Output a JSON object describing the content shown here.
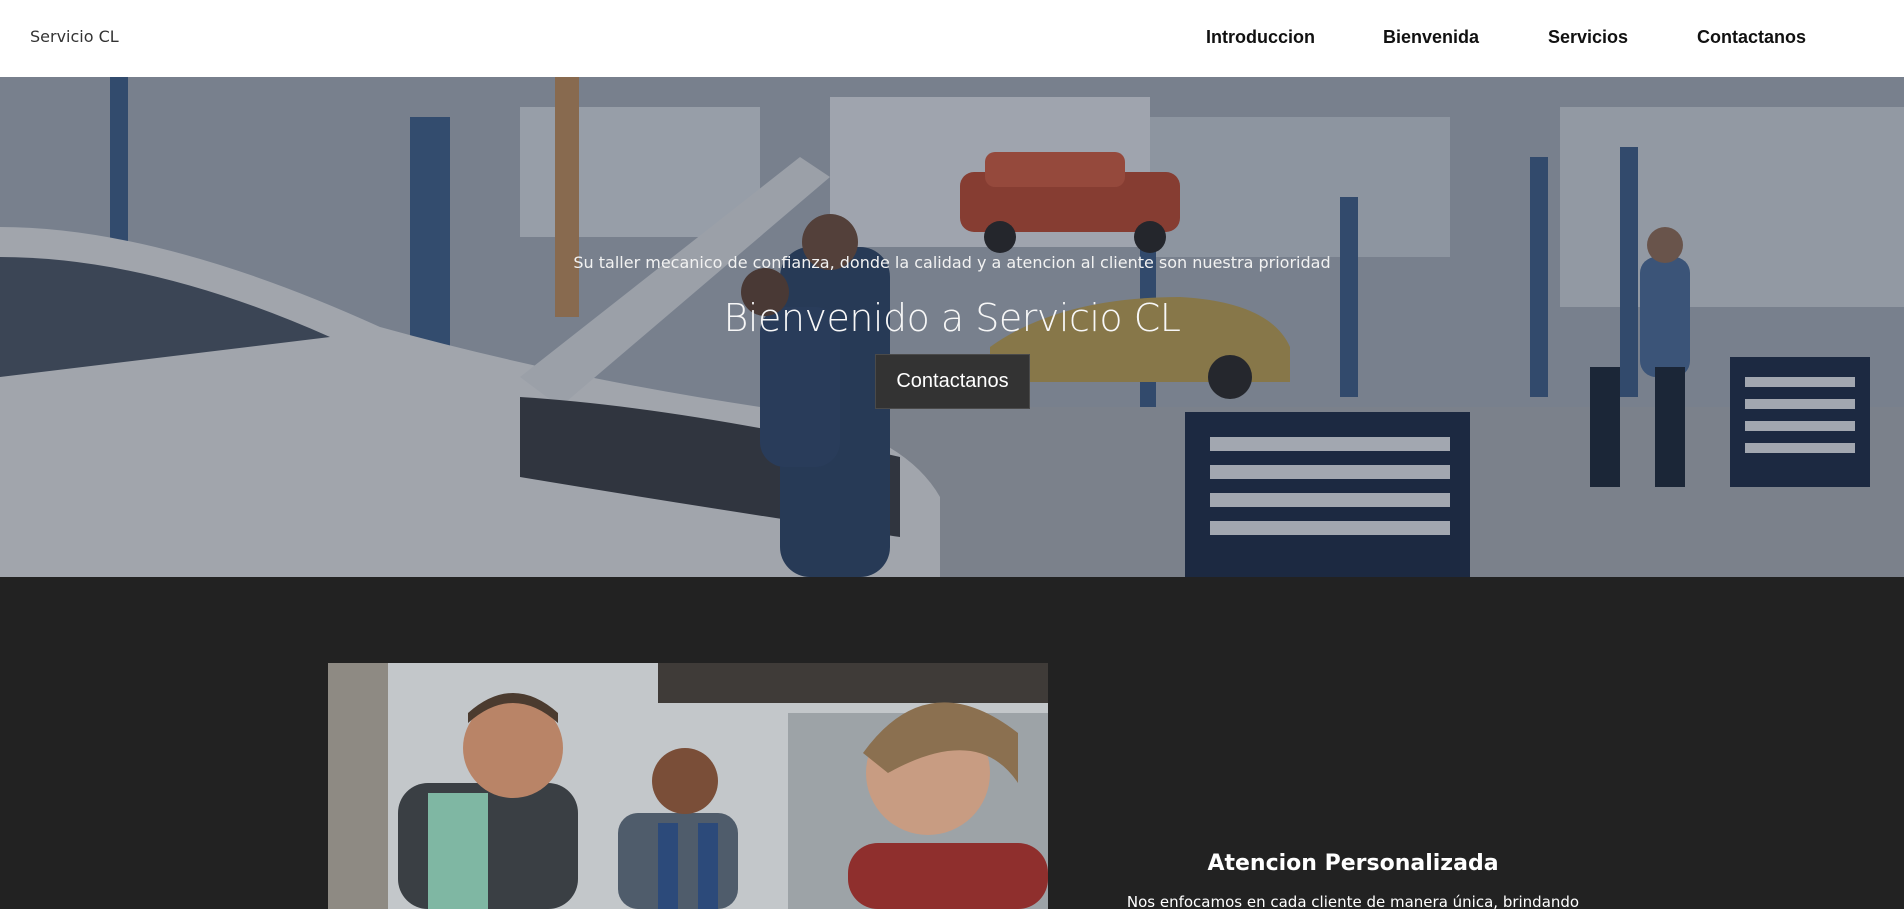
{
  "header": {
    "brand": "Servicio CL",
    "nav": [
      "Introduccion",
      "Bienvenida",
      "Servicios",
      "Contactanos"
    ]
  },
  "hero": {
    "subtitle": "Su taller mecanico de confianza, donde la calidad y a atencion al cliente son nuestra prioridad",
    "title": "Bienvenido a Servicio CL",
    "button": "Contactanos"
  },
  "feature": {
    "title": "Atencion Personalizada",
    "text": "Nos enfocamos en cada cliente de manera única, brindando"
  },
  "colors": {
    "header_bg": "#ffffff",
    "section_bg": "#222222",
    "button_bg": "#333333"
  }
}
